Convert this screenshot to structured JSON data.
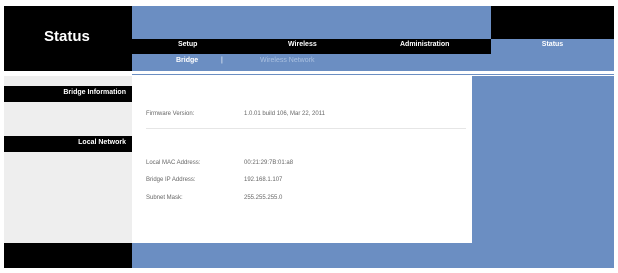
{
  "page": {
    "title": "Status"
  },
  "nav": {
    "tabs": [
      {
        "label": "Setup"
      },
      {
        "label": "Wireless"
      },
      {
        "label": "Administration"
      },
      {
        "label": "Status"
      }
    ],
    "sub_tabs": [
      {
        "label": "Bridge"
      },
      {
        "label": "Wireless Network"
      }
    ],
    "separator": "|"
  },
  "sidebar": {
    "sections": [
      {
        "label": "Bridge Information"
      },
      {
        "label": "Local Network"
      }
    ]
  },
  "bridge_info": {
    "firmware_label": "Firmware Version:",
    "firmware_value": "1.0.01 build 106, Mar 22, 2011"
  },
  "local_network": {
    "mac_label": "Local MAC Address:",
    "mac_value": "00:21:29:7B:01:a8",
    "ip_label": "Bridge IP Address:",
    "ip_value": "192.168.1.107",
    "mask_label": "Subnet Mask:",
    "mask_value": "255.255.255.0"
  },
  "colors": {
    "accent": "#6b8ec2",
    "header": "#000000"
  }
}
